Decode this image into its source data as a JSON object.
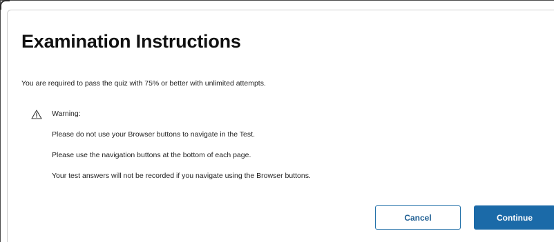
{
  "dialog": {
    "title": "Examination Instructions",
    "intro": "You are required to pass the quiz with 75% or better with unlimited attempts.",
    "warning": {
      "icon": "warning-triangle-icon",
      "label": "Warning:",
      "lines": [
        "Please do not use your Browser buttons to navigate in the Test.",
        "Please use the navigation buttons at the bottom of each page.",
        "Your test answers will not be recorded if you navigate using the Browser buttons."
      ]
    },
    "buttons": {
      "cancel_label": "Cancel",
      "continue_label": "Continue"
    }
  },
  "colors": {
    "primary": "#1b6aa8",
    "border": "#cfcfcf",
    "text": "#222222"
  }
}
